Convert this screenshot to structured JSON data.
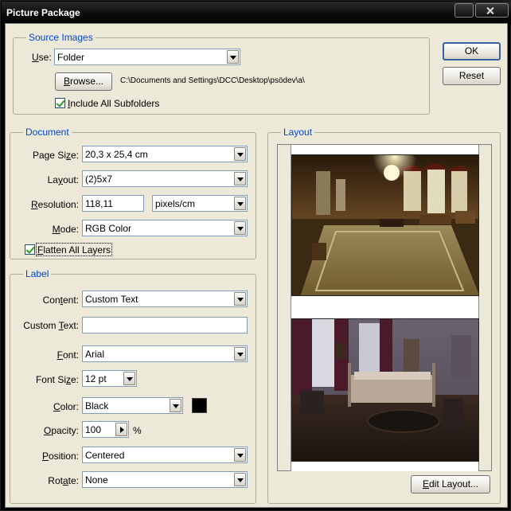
{
  "window": {
    "title": "Picture Package"
  },
  "source": {
    "legend": "Source Images",
    "use_label": "Use:",
    "use_value": "Folder",
    "browse_label": "Browse...",
    "path": "C:\\Documents and Settings\\DCC\\Desktop\\psödev\\a\\",
    "include_subfolders_label": "Include All Subfolders",
    "include_subfolders_checked": true
  },
  "document": {
    "legend": "Document",
    "page_size_label": "Page Size:",
    "page_size_value": "20,3 x 25,4 cm",
    "layout_label": "Layout:",
    "layout_value": "(2)5x7",
    "resolution_label": "Resolution:",
    "resolution_value": "118,11",
    "resolution_unit": "pixels/cm",
    "mode_label": "Mode:",
    "mode_value": "RGB Color",
    "flatten_label": "Flatten All Layers",
    "flatten_checked": true
  },
  "label": {
    "legend": "Label",
    "content_label": "Content:",
    "content_value": "Custom Text",
    "custom_text_label": "Custom Text:",
    "custom_text_value": "",
    "font_label": "Font:",
    "font_value": "Arial",
    "font_size_label": "Font Size:",
    "font_size_value": "12 pt",
    "color_label": "Color:",
    "color_value": "Black",
    "color_swatch": "#000000",
    "opacity_label": "Opacity:",
    "opacity_value": "100",
    "opacity_unit": "%",
    "position_label": "Position:",
    "position_value": "Centered",
    "rotate_label": "Rotate:",
    "rotate_value": "None"
  },
  "layout_panel": {
    "legend": "Layout",
    "edit_layout_label": "Edit Layout...",
    "photos": [
      "palace-hall-photo",
      "bedroom-photo"
    ]
  },
  "buttons": {
    "ok": "OK",
    "reset": "Reset"
  },
  "colors": {
    "legend": "#0046d5",
    "titlebar": "#000000",
    "dialog_bg": "#ece9d8"
  }
}
